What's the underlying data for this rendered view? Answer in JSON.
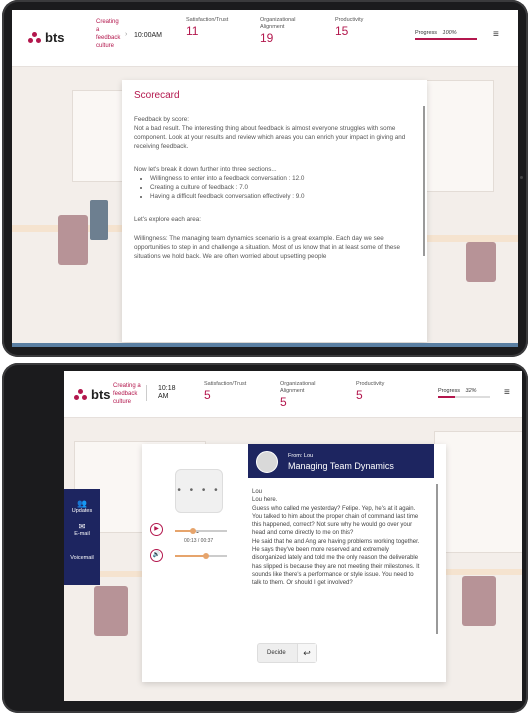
{
  "screen1": {
    "brand": "bts",
    "breadcrumb": [
      "Creating",
      "a",
      "feedback",
      "culture"
    ],
    "time": "10:00AM",
    "metrics": [
      {
        "label": "Satisfaction/Trust",
        "value": "11"
      },
      {
        "label": "Organizational Alignment",
        "value": "19"
      },
      {
        "label": "Productivity",
        "value": "15"
      }
    ],
    "progress": {
      "label": "Progress",
      "value_text": "100%",
      "fraction": 1.0
    },
    "scorecard": {
      "title": "Scorecard",
      "p1": "Feedback by score:",
      "p2": "Not a bad result. The interesting thing about feedback is almost everyone struggles with some component. Look at your results and review which areas you can enrich your impact in giving and receiving feedback.",
      "p3": "Now let's break it down further into three sections...",
      "items": [
        "Willingness to enter into a feedback conversation : 12.0",
        "Creating a culture of feedback : 7.0",
        "Having a difficult feedback conversation effectively : 9.0"
      ],
      "p4": "Let's explore each area:",
      "p5": "Willingness: The managing team dynamics scenario is a great example. Each day we see opportunities to step in and challenge a situation. Most of us know that in at least some of these situations we hold back. We are often worried about upsetting people"
    }
  },
  "screen2": {
    "brand": "bts",
    "breadcrumb": [
      "Creating a",
      "feedback",
      "culture"
    ],
    "time": [
      "10:18",
      "AM"
    ],
    "metrics": [
      {
        "label": "Satisfaction/Trust",
        "value": "5"
      },
      {
        "label": "Organizational Alignment",
        "value": "5"
      },
      {
        "label": "Productivity",
        "value": "5"
      }
    ],
    "progress": {
      "label": "Progress",
      "value_text": "32%",
      "fraction": 0.32
    },
    "sidebar": [
      {
        "label": "Updates",
        "icon": "people-icon"
      },
      {
        "label": "E-mail",
        "icon": "envelope-icon"
      },
      {
        "label": "Voicemail",
        "icon": "voicemail-icon"
      }
    ],
    "audio": {
      "typing": "• • • • •",
      "time": "00:13 / 00:37",
      "progress": 0.35,
      "volume": 0.6
    },
    "message": {
      "from": "From: Lou",
      "subject": "Managing Team Dynamics",
      "body": [
        "Lou",
        "Lou here.",
        "Guess who called me yesterday? Felipe. Yep, he's at it again. You talked to him about the proper chain of command last time this happened, correct? Not sure why he would go over your head and come directly to me on this?",
        "He said that he and Ang are having problems working together. He says they've been more reserved and extremely disorganized lately and told me the only reason the deliverable has slipped is because they are not meeting their milestones. It sounds like there's a performance or style issue. You need to talk to them. Or should I get involved?"
      ]
    },
    "decide_label": "Decide",
    "back_glyph": "↩"
  }
}
